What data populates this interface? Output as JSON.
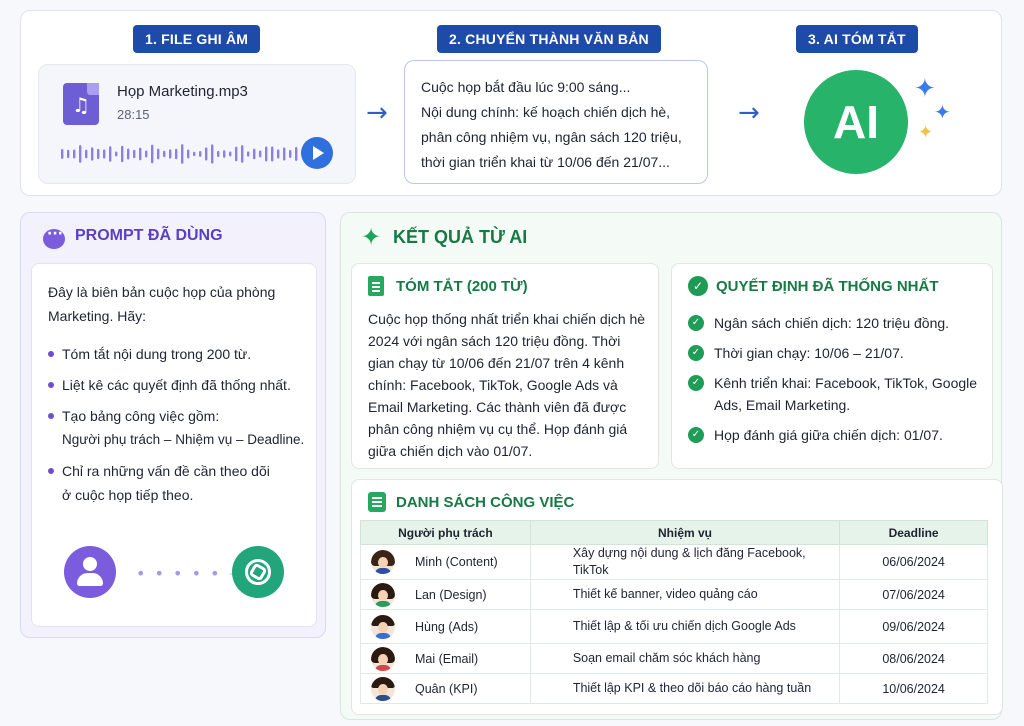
{
  "steps": {
    "step1": "1. FILE GHI ÂM",
    "step2": "2. CHUYỂN THÀNH VĂN BẢN",
    "step3": "3. AI TÓM TẮT"
  },
  "audio_file": {
    "name": "Họp Marketing.mp3",
    "duration": "28:15",
    "icon": "music-file-icon"
  },
  "transcript": {
    "lines": [
      "Cuộc họp bắt đầu lúc 9:00 sáng...",
      "Nội dung chính: kế hoạch chiến dịch hè,",
      "phân công nhiệm vụ, ngân sách 120 triệu,",
      "thời gian triển khai từ 10/06 đến 21/07..."
    ]
  },
  "ai_badge": {
    "label": "AI"
  },
  "prompt": {
    "title": "PROMPT ĐÃ DÙNG",
    "intro": "Đây là biên bản cuộc họp của phòng Marketing. Hãy:",
    "items": [
      "Tóm tắt nội dung trong 200 từ.",
      "Liệt kê các quyết định đã thống nhất.",
      "Tạo bảng công việc gồm:",
      "Chỉ ra những vấn đề cần theo dõi"
    ],
    "item3_sub": "Người phụ trách – Nhiệm vụ – Deadline.",
    "item4_sub": "ở cuộc họp tiếp theo."
  },
  "result": {
    "title": "KẾT QUẢ TỪ AI",
    "summary_title": "TÓM TẮT (200 TỪ)",
    "summary_text": "Cuộc họp thống nhất triển khai chiến dịch hè 2024 với ngân sách 120 triệu đồng. Thời gian chạy từ 10/06 đến 21/07 trên 4 kênh chính: Facebook, TikTok, Google Ads và Email Marketing. Các thành viên đã được phân công nhiệm vụ cụ thể. Họp đánh giá giữa chiến dịch vào 01/07.",
    "decisions_title": "QUYẾT ĐỊNH ĐÃ THỐNG NHẤT",
    "decisions": [
      "Ngân sách chiến dịch: 120 triệu đồng.",
      "Thời gian chạy: 10/06 – 21/07.",
      "Kênh triển khai: Facebook, TikTok, Google Ads, Email Marketing.",
      "Họp đánh giá giữa chiến dịch: 01/07."
    ],
    "tasks_title": "DANH SÁCH CÔNG VIỆC",
    "table": {
      "headers": [
        "Người phụ trách",
        "Nhiệm vụ",
        "Deadline"
      ],
      "rows": [
        {
          "person": "Minh (Content)",
          "task": "Xây dựng nội dung & lịch đăng Facebook, TikTok",
          "deadline": "06/06/2024"
        },
        {
          "person": "Lan (Design)",
          "task": "Thiết kế banner, video quảng cáo",
          "deadline": "07/06/2024"
        },
        {
          "person": "Hùng (Ads)",
          "task": "Thiết lập & tối ưu chiến dịch Google Ads",
          "deadline": "09/06/2024"
        },
        {
          "person": "Mai (Email)",
          "task": "Soạn email chăm sóc khách hàng",
          "deadline": "08/06/2024"
        },
        {
          "person": "Quân (KPI)",
          "task": "Thiết lập KPI & theo dõi báo cáo hàng tuần",
          "deadline": "10/06/2024"
        }
      ]
    }
  },
  "colors": {
    "step_pill": "#1e4aa8",
    "prompt_accent": "#5a3fc4",
    "result_accent": "#177a45",
    "ai_green": "#27b36a"
  }
}
